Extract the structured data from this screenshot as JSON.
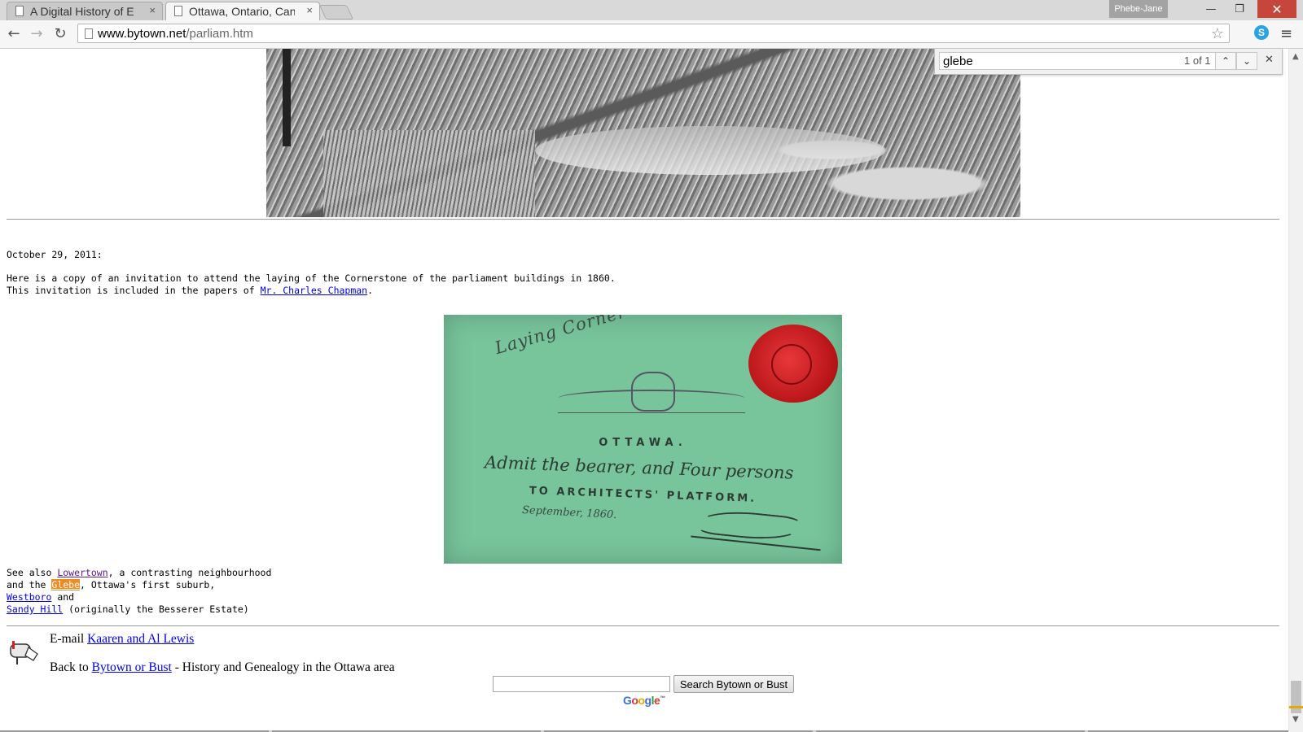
{
  "browser": {
    "tabs": [
      {
        "title": "A Digital History of E",
        "close": "×",
        "active": false
      },
      {
        "title": "Ottawa, Ontario, Can",
        "close": "×",
        "active": true
      }
    ],
    "profile_name": "Phebe-Jane",
    "window_controls": {
      "minimize": "—",
      "maximize": "❐",
      "close": "✕"
    },
    "nav": {
      "back": "←",
      "forward": "→",
      "reload": "↻"
    },
    "url_host": "www.bytown.net",
    "url_path": "/parliam.htm",
    "star": "☆",
    "skype_label": "S",
    "menu": "≡"
  },
  "find_bar": {
    "query": "glebe",
    "count": "1 of 1",
    "prev": "⌃",
    "next": "⌄",
    "close": "✕"
  },
  "page": {
    "date_line": "October 29, 2011:",
    "intro_line1": "Here is a copy of an invitation to attend the laying of the Cornerstone of the parliament buildings in 1860.",
    "intro_line2_prefix": "This invitation is included in the papers of ",
    "intro_link": "Mr. Charles Chapman",
    "intro_line2_suffix": ".",
    "invitation": {
      "arc_text": "Laying Corner Stone of Parliament",
      "city": "OTTAWA.",
      "admit_text": "Admit the bearer, and Four persons",
      "platform_text": "TO ARCHITECTS' PLATFORM.",
      "date_text": "September, 1860."
    },
    "see_also": {
      "l1_prefix": "See also ",
      "lowertown": "Lowertown",
      "l1_suffix": ", a contrasting neighbourhood",
      "l2_prefix": "and the ",
      "glebe": "Glebe",
      "l2_suffix": ", Ottawa's first suburb,",
      "westboro": "Westboro",
      "l3_suffix": " and",
      "sandy_hill": "Sandy Hill",
      "l4_suffix": " (originally the Besserer Estate)"
    },
    "email_prefix": "E-mail ",
    "email_link": "Kaaren and Al Lewis",
    "back_prefix": "Back to ",
    "back_link": "Bytown or Bust",
    "back_suffix": " - History and Genealogy in the Ottawa area",
    "search_button": "Search  Bytown or Bust",
    "google_logo": [
      "G",
      "o",
      "o",
      "g",
      "l",
      "e"
    ],
    "google_tm": "™"
  },
  "colors": {
    "find_highlight": "#f08a24",
    "link": "#0000ee",
    "visited_link": "#551a8b",
    "invitation_green": "#78c49b",
    "seal_red": "#c41a1e"
  }
}
